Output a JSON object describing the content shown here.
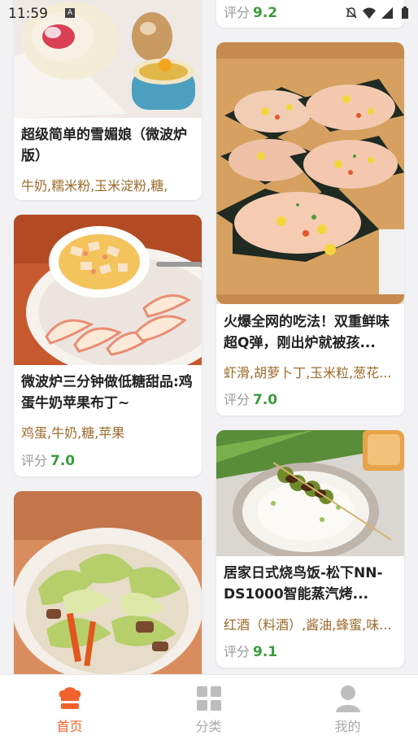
{
  "status": {
    "time": "11:59"
  },
  "cards": [
    {
      "title": "超级简单的雪媚娘（微波炉版）",
      "ingredients": "牛奶,糯米粉,玉米淀粉,糖,",
      "rating_label": "评分",
      "rating": ""
    },
    {
      "title": "微波炉三分钟做低糖甜品:鸡蛋牛奶苹果布丁~",
      "ingredients": "鸡蛋,牛奶,糖,苹果",
      "rating_label": "评分",
      "rating": "7.0"
    },
    {
      "title": "",
      "ingredients": "",
      "rating_label": "",
      "rating": ""
    },
    {
      "title": "",
      "ingredients": "",
      "rating_label": "评分",
      "rating": "9.2"
    },
    {
      "title": "火爆全网的吃法！双重鲜味超Q弹，刚出炉就被孩...",
      "ingredients": "虾滑,胡萝卜丁,玉米粒,葱花...",
      "rating_label": "评分",
      "rating": "7.0"
    },
    {
      "title": "居家日式烧鸟饭-松下NN-DS1000智能蒸汽烤...",
      "ingredients": "红酒（料酒）,酱油,蜂蜜,味...",
      "rating_label": "评分",
      "rating": "9.1"
    }
  ],
  "tabs": [
    {
      "label": "首页",
      "icon": "chef-hat-icon",
      "active": true
    },
    {
      "label": "分类",
      "icon": "grid-icon",
      "active": false
    },
    {
      "label": "我的",
      "icon": "person-icon",
      "active": false
    }
  ],
  "colors": {
    "accent": "#f2622c",
    "rating": "#3b9b3b",
    "ingredients": "#9b6a2a"
  }
}
